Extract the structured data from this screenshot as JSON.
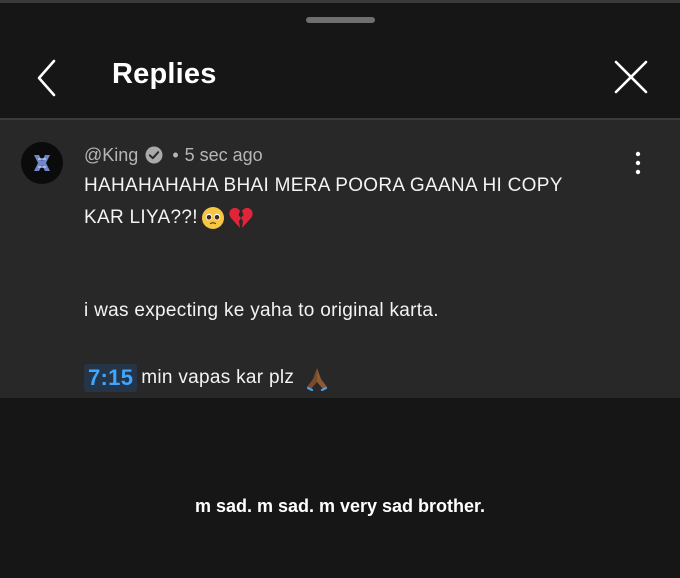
{
  "header": {
    "title": "Replies",
    "back_icon": "chevron-left-icon",
    "close_icon": "close-icon"
  },
  "comment": {
    "author": "@King",
    "separator": "•",
    "time": "5 sec ago",
    "line1": "HAHAHAHAHA BHAI MERA POORA GAANA HI COPY",
    "line2": "KAR LIYA??!",
    "line3": "i was expecting ke yaha to original karta.",
    "timestamp_link": "7:15",
    "line4": "min vapas kar plz",
    "emojis": [
      "pleading-face-icon",
      "broken-heart-icon",
      "folded-hands-icon"
    ],
    "colors": {
      "link": "#3ea6ff",
      "link_bg": "#253447",
      "card_bg": "#282828"
    }
  },
  "caption": "m sad. m sad. m very sad brother."
}
